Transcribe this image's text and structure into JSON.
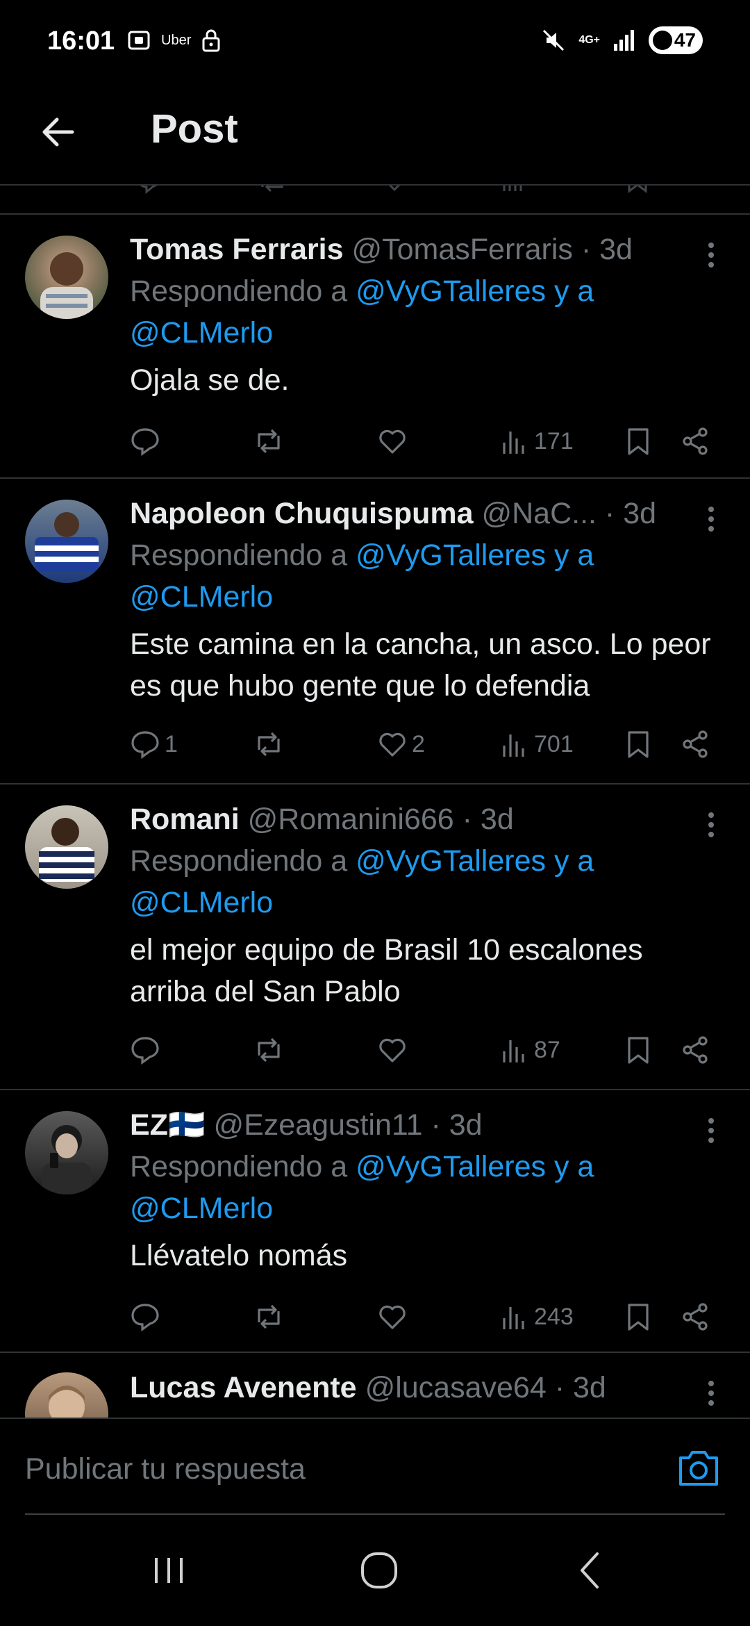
{
  "status_bar": {
    "time": "16:01",
    "uber_label": "Uber",
    "network": "4G+",
    "battery": "47"
  },
  "header": {
    "title": "Post"
  },
  "tweets": [
    {
      "name": "Tomas Ferraris",
      "handle": "@TomasFerraris",
      "time": "· 3d",
      "reply_prefix": "Respondiendo a ",
      "mention1": "@VyGTalleres y a",
      "mention2": "@CLMerlo",
      "text": "Ojala se de.",
      "replies": "",
      "likes": "",
      "views": "171"
    },
    {
      "name": "Napoleon Chuquispuma",
      "handle": "@NaC...",
      "time": "· 3d",
      "reply_prefix": "Respondiendo a ",
      "mention1": "@VyGTalleres y a",
      "mention2": "@CLMerlo",
      "text": "Este camina en la cancha, un asco. Lo peor es que hubo gente que lo defendia",
      "replies": "1",
      "likes": "2",
      "views": "701"
    },
    {
      "name": "Romani",
      "handle": "@Romanini666",
      "time": "· 3d",
      "reply_prefix": "Respondiendo a ",
      "mention1": "@VyGTalleres y a",
      "mention2": "@CLMerlo",
      "text": "el mejor equipo de Brasil 10 escalones arriba del San Pablo",
      "replies": "",
      "likes": "",
      "views": "87"
    },
    {
      "name": "EZ🇫🇮",
      "handle": "@Ezeagustin11",
      "time": "· 3d",
      "reply_prefix": "Respondiendo a ",
      "mention1": "@VyGTalleres y a",
      "mention2": "@CLMerlo",
      "text": "Llévatelo nomás",
      "replies": "",
      "likes": "",
      "views": "243"
    },
    {
      "name": "Lucas Avenente",
      "handle": "@lucasave64",
      "time": "· 3d"
    }
  ],
  "reply_bar": {
    "placeholder": "Publicar tu respuesta"
  },
  "colors": {
    "accent": "#1d9bf0",
    "muted": "#71767b",
    "text": "#e7e9ea",
    "divider": "#2f3336"
  }
}
